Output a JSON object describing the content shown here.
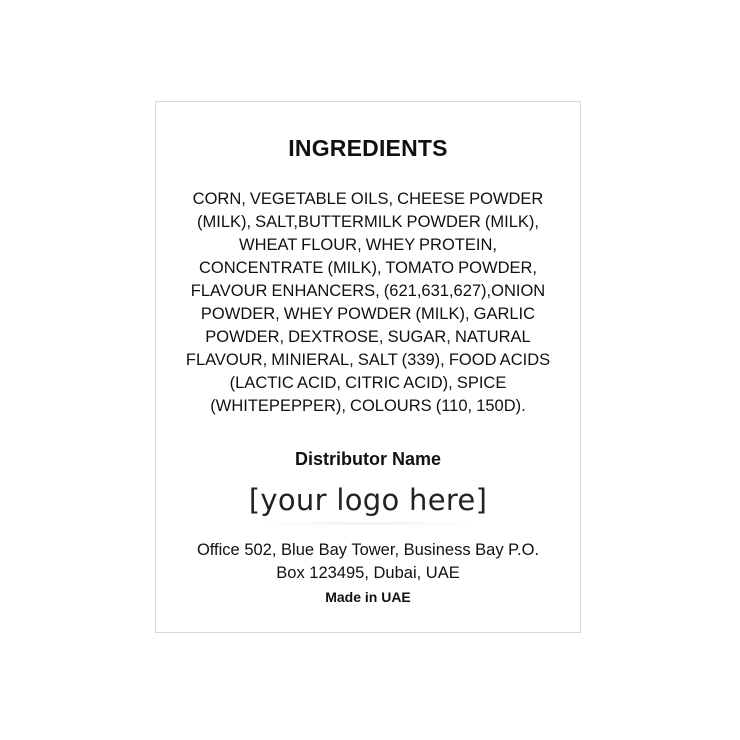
{
  "label": {
    "heading": "INGREDIENTS",
    "ingredients_lines": [
      "CORN, VEGETABLE OILS, CHEESE POWDER",
      "(MILK), SALT,BUTTERMILK POWDER (MILK),",
      "WHEAT FLOUR, WHEY PROTEIN,",
      "CONCENTRATE (MILK), TOMATO POWDER,",
      "FLAVOUR ENHANCERS, (621,631,627),ONION",
      "POWDER, WHEY POWDER (MILK), GARLIC",
      "POWDER, DEXTROSE, SUGAR, NATURAL",
      "FLAVOUR, MINIERAL, SALT (339), FOOD ACIDS",
      "(LACTIC ACID, CITRIC ACID), SPICE",
      "(WHITEPEPPER), COLOURS (110, 150D)."
    ],
    "distributor_label": "Distributor Name",
    "logo_placeholder": "[your logo here]",
    "address_lines": [
      "Office 502, Blue Bay Tower, Business Bay P.O.",
      "Box 123495, Dubai, UAE"
    ],
    "origin": "Made in UAE"
  }
}
